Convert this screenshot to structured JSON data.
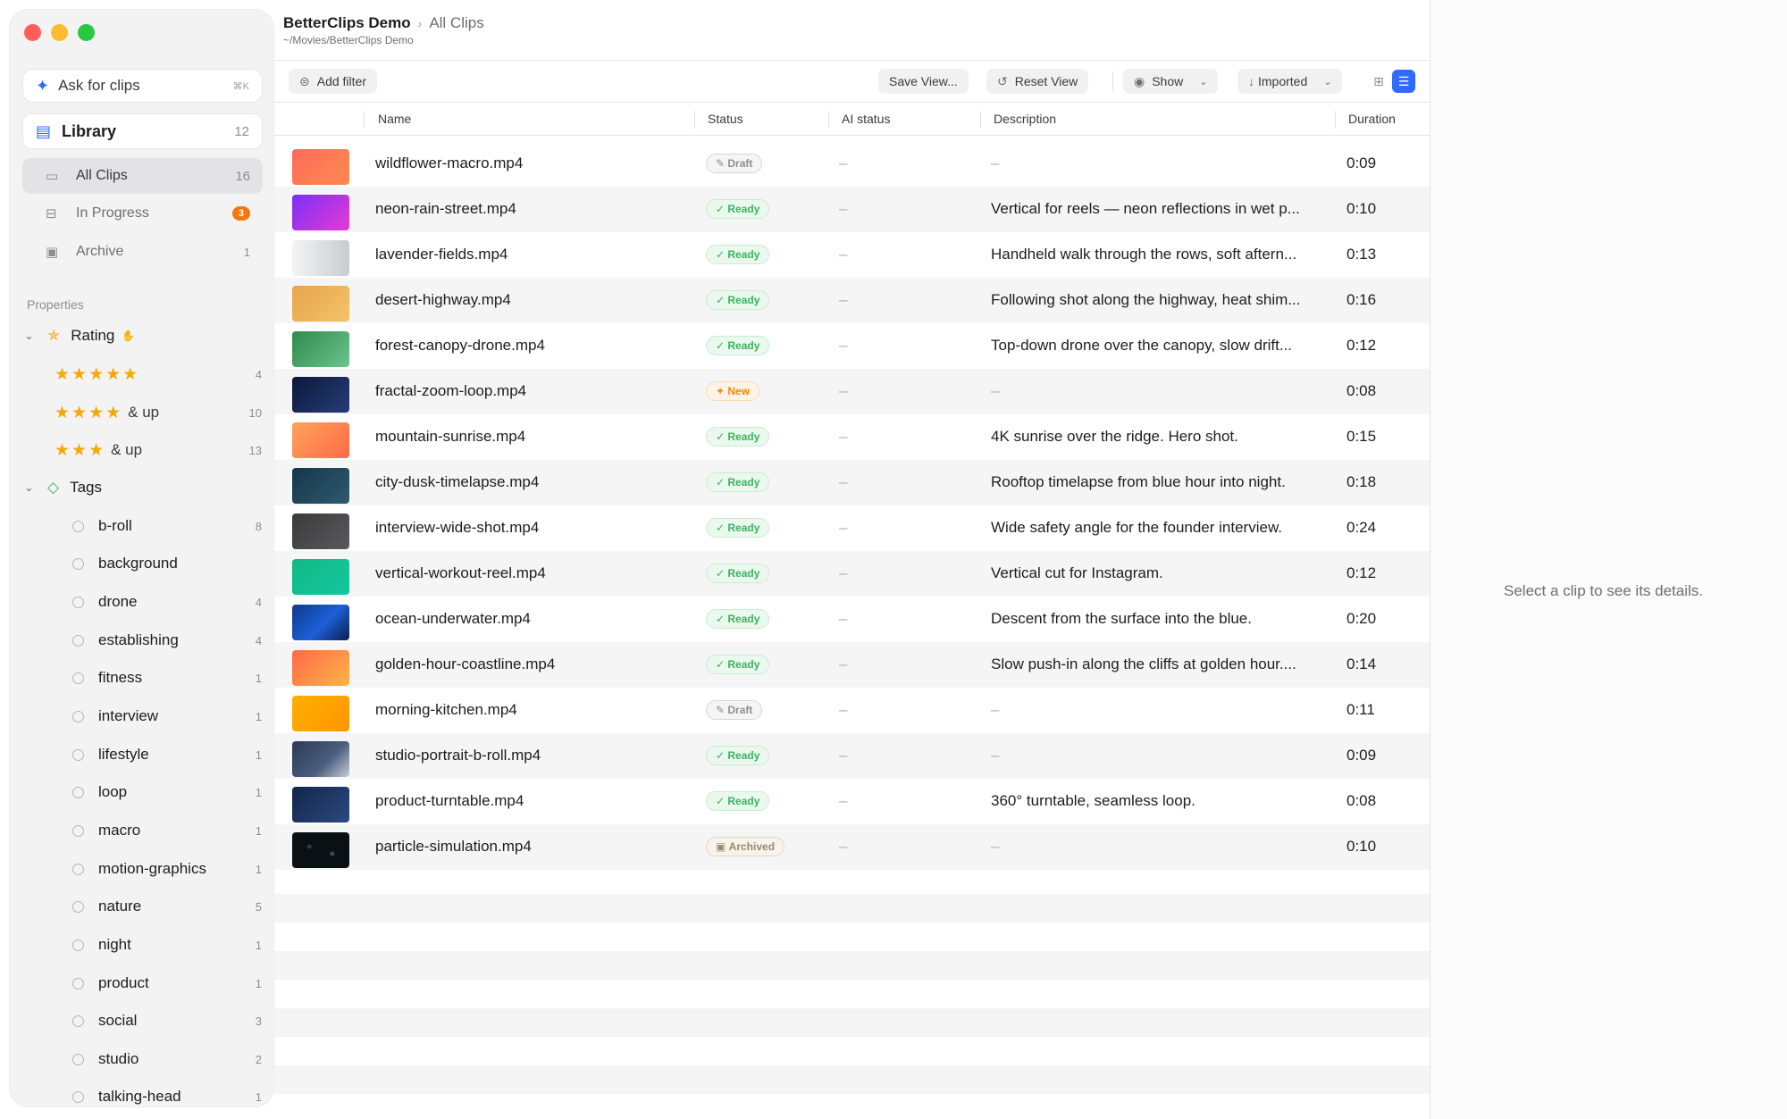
{
  "sidebar": {
    "ask": {
      "label": "Ask for clips",
      "shortcut": "⌘K"
    },
    "library": {
      "label": "Library",
      "count": "12"
    },
    "nav": [
      {
        "label": "All Clips",
        "count": "16"
      },
      {
        "label": "In Progress",
        "badge": "3"
      },
      {
        "label": "Archive",
        "count": "1"
      }
    ],
    "properties_label": "Properties",
    "rating": {
      "label": "Rating",
      "items": [
        {
          "stars": "★★★★★",
          "suffix": "",
          "count": "4"
        },
        {
          "stars": "★★★★",
          "suffix": "& up",
          "count": "10"
        },
        {
          "stars": "★★★",
          "suffix": "& up",
          "count": "13"
        }
      ]
    },
    "tags": {
      "label": "Tags",
      "items": [
        {
          "label": "b-roll",
          "count": "8"
        },
        {
          "label": "background",
          "count": ""
        },
        {
          "label": "drone",
          "count": "4"
        },
        {
          "label": "establishing",
          "count": "4"
        },
        {
          "label": "fitness",
          "count": "1"
        },
        {
          "label": "interview",
          "count": "1"
        },
        {
          "label": "lifestyle",
          "count": "1"
        },
        {
          "label": "loop",
          "count": "1"
        },
        {
          "label": "macro",
          "count": "1"
        },
        {
          "label": "motion-graphics",
          "count": "1"
        },
        {
          "label": "nature",
          "count": "5"
        },
        {
          "label": "night",
          "count": "1"
        },
        {
          "label": "product",
          "count": "1"
        },
        {
          "label": "social",
          "count": "3"
        },
        {
          "label": "studio",
          "count": "2"
        },
        {
          "label": "talking-head",
          "count": "1"
        }
      ]
    }
  },
  "header": {
    "project": "BetterClips Demo",
    "separator": "›",
    "current": "All Clips",
    "path": "~/Movies/BetterClips Demo"
  },
  "toolbar": {
    "add_filter": "Add filter",
    "save_view": "Save View...",
    "reset_view": "Reset View",
    "show": "Show",
    "sort": "Imported"
  },
  "table": {
    "columns": [
      "Name",
      "Status",
      "AI status",
      "Description",
      "Duration"
    ],
    "rows": [
      {
        "name": "wildflower-macro.mp4",
        "status": "Draft",
        "ai": "–",
        "desc": "–",
        "dur": "0:09"
      },
      {
        "name": "neon-rain-street.mp4",
        "status": "Ready",
        "ai": "–",
        "desc": "Vertical for reels — neon reflections in wet p...",
        "dur": "0:10"
      },
      {
        "name": "lavender-fields.mp4",
        "status": "Ready",
        "ai": "–",
        "desc": "Handheld walk through the rows, soft aftern...",
        "dur": "0:13"
      },
      {
        "name": "desert-highway.mp4",
        "status": "Ready",
        "ai": "–",
        "desc": "Following shot along the highway, heat shim...",
        "dur": "0:16"
      },
      {
        "name": "forest-canopy-drone.mp4",
        "status": "Ready",
        "ai": "–",
        "desc": "Top-down drone over the canopy, slow drift...",
        "dur": "0:12"
      },
      {
        "name": "fractal-zoom-loop.mp4",
        "status": "New",
        "ai": "–",
        "desc": "–",
        "dur": "0:08"
      },
      {
        "name": "mountain-sunrise.mp4",
        "status": "Ready",
        "ai": "–",
        "desc": "4K sunrise over the ridge. Hero shot.",
        "dur": "0:15"
      },
      {
        "name": "city-dusk-timelapse.mp4",
        "status": "Ready",
        "ai": "–",
        "desc": "Rooftop timelapse from blue hour into night.",
        "dur": "0:18"
      },
      {
        "name": "interview-wide-shot.mp4",
        "status": "Ready",
        "ai": "–",
        "desc": "Wide safety angle for the founder interview.",
        "dur": "0:24"
      },
      {
        "name": "vertical-workout-reel.mp4",
        "status": "Ready",
        "ai": "–",
        "desc": "Vertical cut for Instagram.",
        "dur": "0:12"
      },
      {
        "name": "ocean-underwater.mp4",
        "status": "Ready",
        "ai": "–",
        "desc": "Descent from the surface into the blue.",
        "dur": "0:20"
      },
      {
        "name": "golden-hour-coastline.mp4",
        "status": "Ready",
        "ai": "–",
        "desc": "Slow push-in along the cliffs at golden hour....",
        "dur": "0:14"
      },
      {
        "name": "morning-kitchen.mp4",
        "status": "Draft",
        "ai": "–",
        "desc": "–",
        "dur": "0:11"
      },
      {
        "name": "studio-portrait-b-roll.mp4",
        "status": "Ready",
        "ai": "–",
        "desc": "–",
        "dur": "0:09"
      },
      {
        "name": "product-turntable.mp4",
        "status": "Ready",
        "ai": "–",
        "desc": "360° turntable, seamless loop.",
        "dur": "0:08"
      },
      {
        "name": "particle-simulation.mp4",
        "status": "Archived",
        "ai": "–",
        "desc": "–",
        "dur": "0:10"
      }
    ]
  },
  "detail": {
    "empty_message": "Select a clip to see its details."
  },
  "colors": {
    "accent": "#2f6bff",
    "ready": "#3bb25c",
    "new": "#f5890a",
    "badge": "#f5760a",
    "star": "#f5a80a"
  }
}
